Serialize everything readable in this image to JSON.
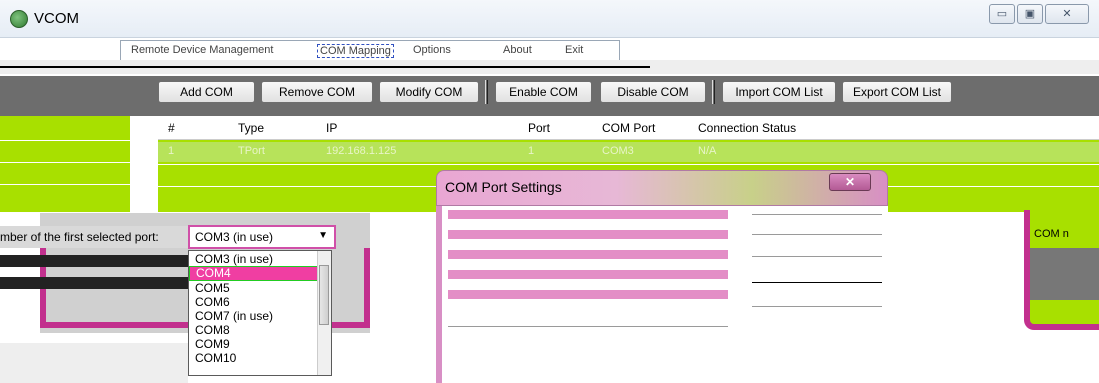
{
  "window": {
    "title": "VCOM",
    "controls": {
      "minimize": "▭",
      "maximize": "▣",
      "close": "✕"
    }
  },
  "menu": {
    "items": [
      "Remote Device Management",
      "COM Mapping",
      "Options",
      "About",
      "Exit"
    ]
  },
  "toolbar": {
    "buttons": [
      "Add COM",
      "Remove COM",
      "Modify COM",
      "Enable COM",
      "Disable COM",
      "Import COM List",
      "Export COM List"
    ]
  },
  "table": {
    "columns": [
      "#",
      "Type",
      "IP",
      "Port",
      "COM Port",
      "Connection Status"
    ],
    "rows": [
      {
        "num": "1",
        "type": "TPort",
        "ip": "192.168.1.125",
        "port": "1",
        "com_port": "COM3",
        "status": "N/A"
      }
    ]
  },
  "dialog": {
    "title": "COM Port Settings",
    "close_label": "✕"
  },
  "combo": {
    "label": "mber of the first selected port:",
    "value": "COM3  (in use)",
    "options": [
      "COM3  (in use)",
      "COM4",
      "COM5",
      "COM6",
      "COM7  (in use)",
      "COM8",
      "COM9",
      "COM10"
    ],
    "selected_index": 1
  },
  "right_label": "COM n",
  "colors": {
    "highlight": "#f03ea2",
    "accent": "#a8e000",
    "dialog": "#d88fc5"
  }
}
